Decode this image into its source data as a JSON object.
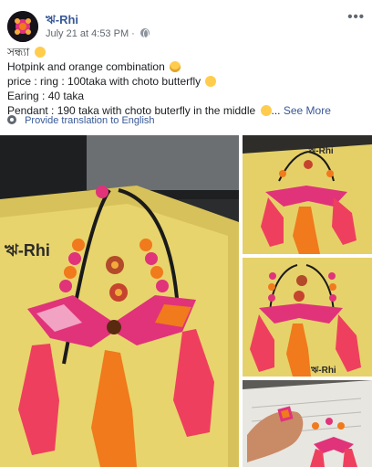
{
  "post": {
    "page_name": "ঋ-Rhi",
    "timestamp": "July 21 at 4:53 PM",
    "caption": {
      "line1": "সন্ধ্যা",
      "line2": "Hotpink and orange combination",
      "line3": "price : ring : 100taka with choto butterfly",
      "line4": "Earing : 40 taka",
      "line5": "Pendant : 190 taka with choto buterfly in the middle",
      "see_more": "See More",
      "ellipsis": "..."
    },
    "translate_label": "Provide translation to English"
  },
  "photos": {
    "watermark": "ঋ-Rhi",
    "count": 4
  },
  "colors": {
    "link": "#385898",
    "meta": "#616770",
    "hotpink": "#e0337a",
    "orange": "#f07a1c",
    "notebook_yellow": "#e9d36a"
  },
  "icons": [
    "avatar",
    "globe-icon",
    "more-options-icon",
    "heart-emoji",
    "star-eyes-emoji",
    "smile-emoji",
    "gear-icon"
  ]
}
